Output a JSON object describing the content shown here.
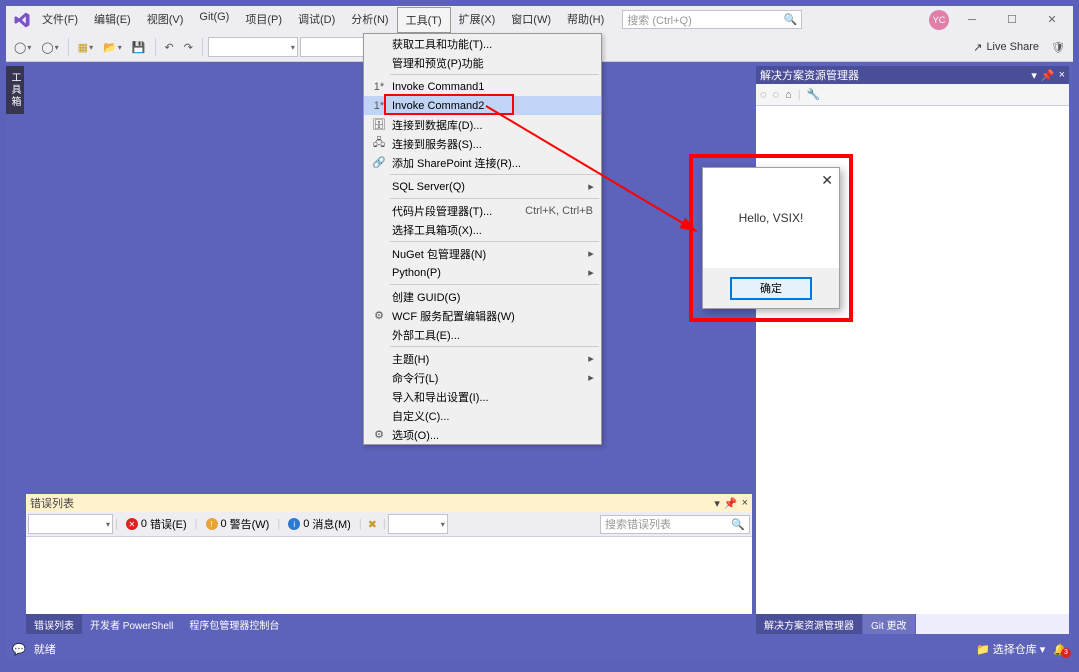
{
  "menus": [
    "文件(F)",
    "编辑(E)",
    "视图(V)",
    "Git(G)",
    "项目(P)",
    "调试(D)",
    "分析(N)",
    "工具(T)",
    "扩展(X)",
    "窗口(W)",
    "帮助(H)"
  ],
  "active_menu_index": 7,
  "search_placeholder": "搜索 (Ctrl+Q)",
  "avatar": "YC",
  "live_share": "Live Share",
  "toolbox_label": "工具箱",
  "right_panel": {
    "title": "解决方案资源管理器",
    "tabs": [
      "解决方案资源管理器",
      "Git 更改"
    ]
  },
  "error_panel": {
    "title": "错误列表",
    "filters": {
      "errors": "错误(E)",
      "warnings": "警告(W)",
      "messages": "消息(M)",
      "err_count": "0",
      "warn_count": "0",
      "msg_count": "0"
    },
    "search_placeholder": "搜索错误列表",
    "tabs": [
      "错误列表",
      "开发者 PowerShell",
      "程序包管理器控制台"
    ]
  },
  "dropdown": [
    {
      "t": "item",
      "label": "获取工具和功能(T)..."
    },
    {
      "t": "item",
      "label": "管理和预览(P)功能"
    },
    {
      "t": "sep"
    },
    {
      "t": "item",
      "label": "Invoke Command1",
      "icon": "1*"
    },
    {
      "t": "item",
      "label": "Invoke Command2",
      "icon": "1*",
      "hl": true,
      "redbox": true
    },
    {
      "t": "item",
      "label": "连接到数据库(D)...",
      "icon": "db"
    },
    {
      "t": "item",
      "label": "连接到服务器(S)...",
      "icon": "srv"
    },
    {
      "t": "item",
      "label": "添加 SharePoint 连接(R)...",
      "icon": "sp"
    },
    {
      "t": "sep"
    },
    {
      "t": "item",
      "label": "SQL Server(Q)",
      "sub": true
    },
    {
      "t": "sep"
    },
    {
      "t": "item",
      "label": "代码片段管理器(T)...",
      "shortcut": "Ctrl+K, Ctrl+B"
    },
    {
      "t": "item",
      "label": "选择工具箱项(X)..."
    },
    {
      "t": "sep"
    },
    {
      "t": "item",
      "label": "NuGet 包管理器(N)",
      "sub": true
    },
    {
      "t": "item",
      "label": "Python(P)",
      "sub": true
    },
    {
      "t": "sep"
    },
    {
      "t": "item",
      "label": "创建 GUID(G)"
    },
    {
      "t": "item",
      "label": "WCF 服务配置编辑器(W)",
      "icon": "wcf"
    },
    {
      "t": "item",
      "label": "外部工具(E)..."
    },
    {
      "t": "sep"
    },
    {
      "t": "item",
      "label": "主题(H)",
      "sub": true
    },
    {
      "t": "item",
      "label": "命令行(L)",
      "sub": true
    },
    {
      "t": "item",
      "label": "导入和导出设置(I)..."
    },
    {
      "t": "item",
      "label": "自定义(C)..."
    },
    {
      "t": "item",
      "label": "选项(O)...",
      "icon": "gear"
    }
  ],
  "dialog": {
    "message": "Hello, VSIX!",
    "ok": "确定"
  },
  "status": {
    "ready": "就绪",
    "repo": "选择仓库 ▾",
    "bell_count": "3"
  }
}
